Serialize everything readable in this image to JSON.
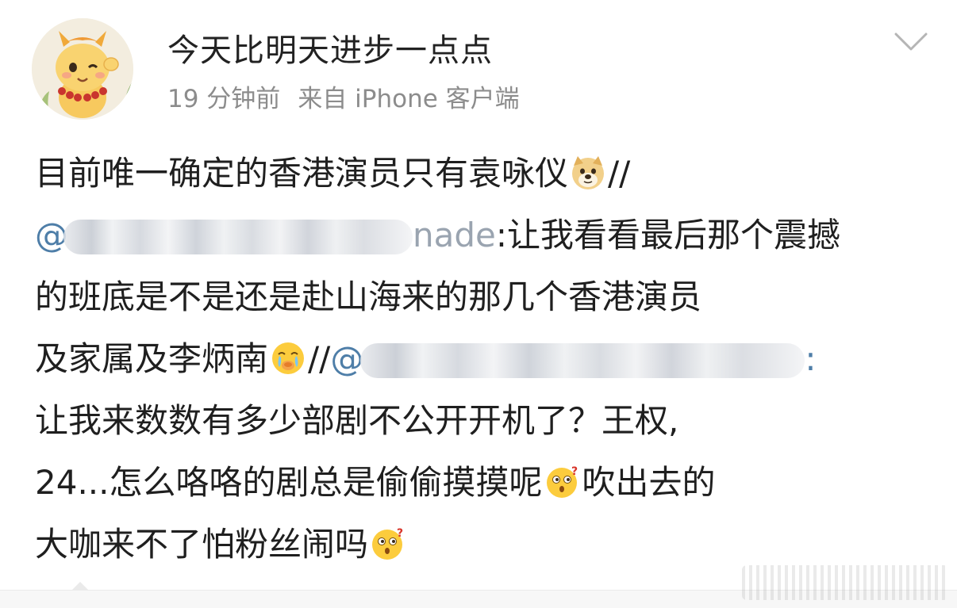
{
  "post": {
    "username": "今天比明天进步一点点",
    "time": "19 分钟前",
    "source": "来自 iPhone 客户端",
    "icons": {
      "avatar": "dragon-avatar-icon",
      "more": "chevron-down-icon",
      "emoji_doge": "doge-emoji-icon",
      "emoji_cry": "crying-emoji-icon",
      "emoji_wonder": "wondering-emoji-icon"
    },
    "colors": {
      "text": "#1f1f1f",
      "link": "#4e7ea8",
      "meta": "#8c8c8c"
    }
  },
  "content": {
    "line1": "目前唯一确定的香港演员只有袁咏仪",
    "line1_tail": "//",
    "line2_mention_start": "@",
    "line2_mention_end": "nade",
    "line2_text": ":让我看看最后那个震撼",
    "line3": "的班底是不是还是赴山海来的那几个香港演员",
    "line4": "及家属及李炳南",
    "line4_sep": "//",
    "line4_mention_start": "@",
    "line4_mention_tail": ":",
    "line5": "让我来数数有多少部剧不公开开机了？王权,",
    "line6": "24...怎么咯咯的剧总是偷偷摸摸呢",
    "line6_tail": "吹出去的",
    "line7": "大咖来不了怕粉丝闹吗"
  }
}
